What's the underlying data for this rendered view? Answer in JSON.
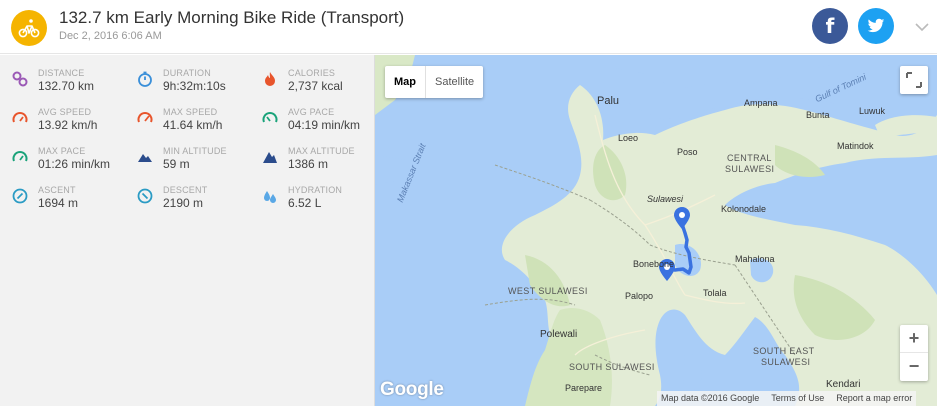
{
  "header": {
    "title": "132.7 km Early Morning Bike Ride (Transport)",
    "date": "Dec 2, 2016 6:06 AM",
    "facebook_glyph": "f",
    "accent_color": "#f5b400"
  },
  "stats": [
    {
      "label": "DISTANCE",
      "value": "132.70 km",
      "icon": "distance-icon",
      "color": "#9b59b6"
    },
    {
      "label": "DURATION",
      "value": "9h:32m:10s",
      "icon": "stopwatch-icon",
      "color": "#3a8fd9"
    },
    {
      "label": "CALORIES",
      "value": "2,737 kcal",
      "icon": "flame-icon",
      "color": "#e8552c"
    },
    {
      "label": "AVG SPEED",
      "value": "13.92 km/h",
      "icon": "speedometer-icon",
      "color": "#e8552c"
    },
    {
      "label": "MAX SPEED",
      "value": "41.64 km/h",
      "icon": "speedometer-icon",
      "color": "#e8552c"
    },
    {
      "label": "AVG PACE",
      "value": "04:19 min/km",
      "icon": "speedometer-icon",
      "color": "#1aa37a"
    },
    {
      "label": "MAX PACE",
      "value": "01:26 min/km",
      "icon": "speedometer-icon",
      "color": "#1aa37a"
    },
    {
      "label": "MIN ALTITUDE",
      "value": "59 m",
      "icon": "mountain-icon",
      "color": "#2b4c8c"
    },
    {
      "label": "MAX ALTITUDE",
      "value": "1386 m",
      "icon": "mountain-icon",
      "color": "#2b4c8c"
    },
    {
      "label": "ASCENT",
      "value": "1694 m",
      "icon": "compass-icon",
      "color": "#2a9bc4"
    },
    {
      "label": "DESCENT",
      "value": "2190 m",
      "icon": "compass-icon",
      "color": "#2a9bc4"
    },
    {
      "label": "HYDRATION",
      "value": "6.52 L",
      "icon": "water-drops-icon",
      "color": "#5aa8e6"
    }
  ],
  "map": {
    "map_button": "Map",
    "satellite_button": "Satellite",
    "zoom_in": "+",
    "zoom_out": "−",
    "logo": "Google",
    "attribution": [
      "Map data ©2016 Google",
      "Terms of Use",
      "Report a map error"
    ],
    "labels": [
      {
        "text": "Palu"
      },
      {
        "text": "Loeo"
      },
      {
        "text": "Poso"
      },
      {
        "text": "Ampana"
      },
      {
        "text": "Bunta"
      },
      {
        "text": "Luwuk"
      },
      {
        "text": "Matindok"
      },
      {
        "text": "CENTRAL"
      },
      {
        "text": "SULAWESI"
      },
      {
        "text": "Sulawesi"
      },
      {
        "text": "Kolonodale"
      },
      {
        "text": "Mahalona"
      },
      {
        "text": "Bonebone"
      },
      {
        "text": "Palopo"
      },
      {
        "text": "Tolala"
      },
      {
        "text": "WEST SULAWESI"
      },
      {
        "text": "Polewali"
      },
      {
        "text": "SOUTH SULAWESI"
      },
      {
        "text": "SOUTH EAST"
      },
      {
        "text": "SULAWESI"
      },
      {
        "text": "Parepare"
      },
      {
        "text": "Kendari"
      },
      {
        "text": "Makassar Strait"
      },
      {
        "text": "Gulf of Tomini"
      }
    ]
  }
}
